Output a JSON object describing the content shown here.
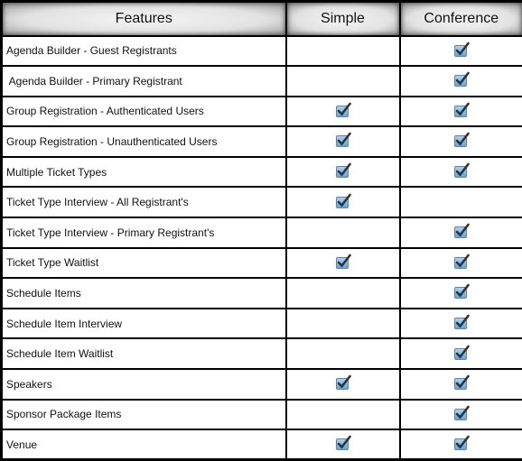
{
  "header": {
    "features": "Features",
    "simple": "Simple",
    "conference": "Conference"
  },
  "colors": {
    "checkbox_fill": "#5aa6e6",
    "check_mark": "#333333"
  },
  "check_icon": "checkbox-checked-icon",
  "rows": [
    {
      "feature": "Agenda Builder - Guest Registrants",
      "simple": false,
      "conference": true
    },
    {
      "feature": " Agenda Builder - Primary Registrant",
      "simple": false,
      "conference": true
    },
    {
      "feature": "Group Registration - Authenticated Users",
      "simple": true,
      "conference": true
    },
    {
      "feature": "Group Registration - Unauthenticated Users",
      "simple": true,
      "conference": true
    },
    {
      "feature": "Multiple Ticket Types",
      "simple": true,
      "conference": true
    },
    {
      "feature": "Ticket Type Interview - All Registrant's",
      "simple": true,
      "conference": false
    },
    {
      "feature": "Ticket Type Interview - Primary Registrant's",
      "simple": false,
      "conference": true
    },
    {
      "feature": "Ticket Type Waitlist",
      "simple": true,
      "conference": true
    },
    {
      "feature": "Schedule Items",
      "simple": false,
      "conference": true
    },
    {
      "feature": "Schedule Item Interview",
      "simple": false,
      "conference": true
    },
    {
      "feature": "Schedule Item Waitlist",
      "simple": false,
      "conference": true
    },
    {
      "feature": "Speakers",
      "simple": true,
      "conference": true
    },
    {
      "feature": "Sponsor Package Items",
      "simple": false,
      "conference": true
    },
    {
      "feature": "Venue",
      "simple": true,
      "conference": true
    }
  ]
}
